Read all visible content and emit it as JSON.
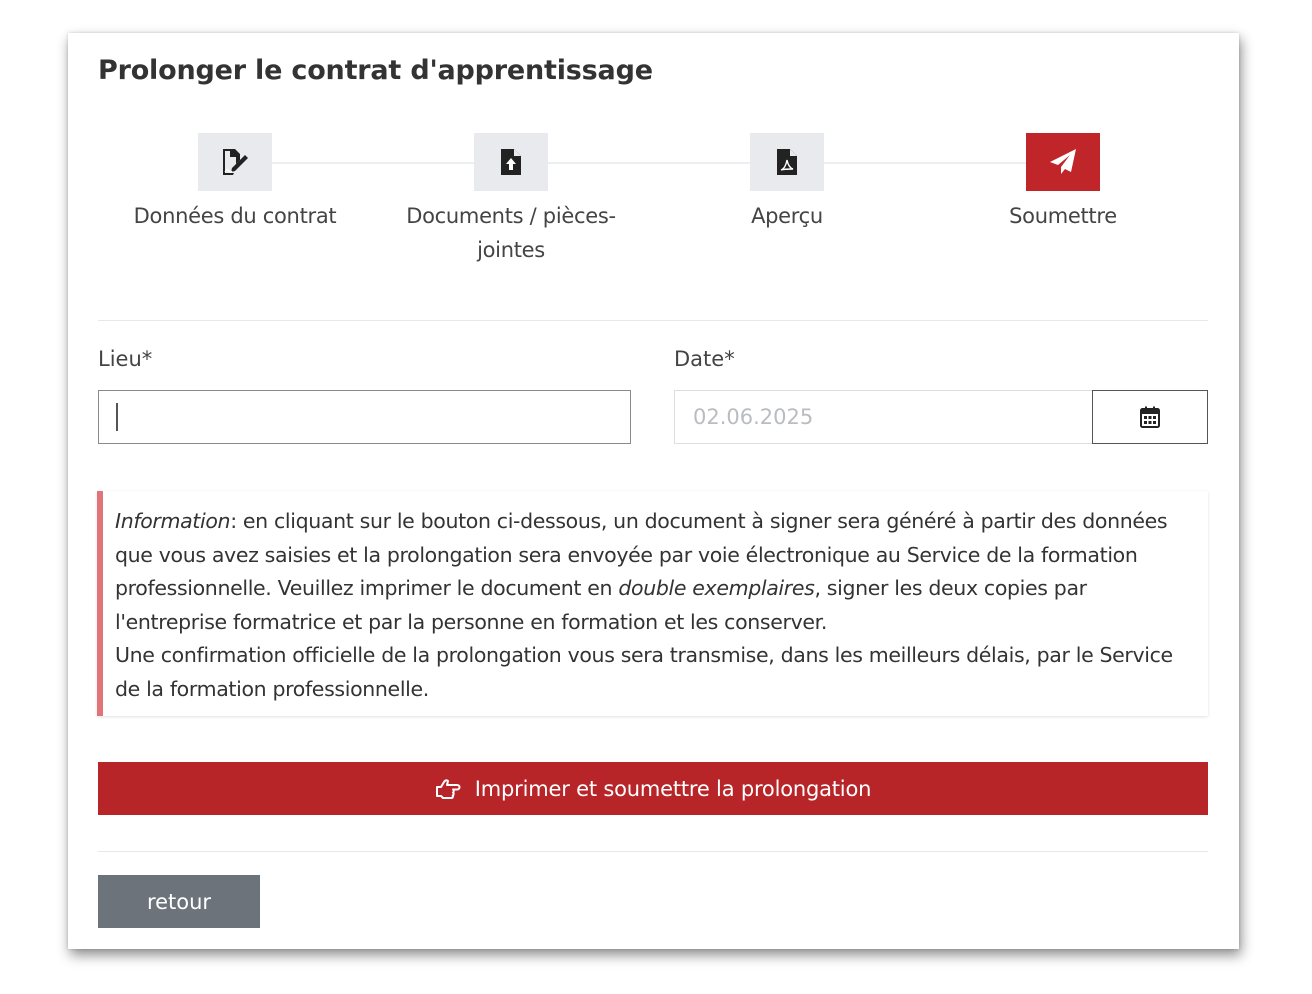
{
  "page": {
    "title": "Prolonger le contrat d'apprentissage"
  },
  "stepper": {
    "steps": [
      {
        "label": "Données du contrat",
        "icon": "file-signature-icon",
        "active": false
      },
      {
        "label": "Documents / pièces-jointes",
        "icon": "file-upload-icon",
        "active": false
      },
      {
        "label": "Aperçu",
        "icon": "file-pdf-icon",
        "active": false
      },
      {
        "label": "Soumettre",
        "icon": "paper-plane-icon",
        "active": true
      }
    ]
  },
  "form": {
    "lieu": {
      "label": "Lieu*",
      "value": ""
    },
    "date": {
      "label": "Date*",
      "placeholder": "02.06.2025",
      "button_icon": "calendar-icon"
    }
  },
  "info": {
    "lead": "Information",
    "text1": ": en cliquant sur le bouton ci-dessous, un document à signer sera généré à partir des données que vous avez saisies et la prolongation sera envoyée par voie électronique au Service de la formation professionnelle. Veuillez imprimer le document en ",
    "emphasis": "double exemplaires",
    "text2": ", signer les deux copies par l'entreprise formatrice et par la personne en formation et les conserver.",
    "paragraph2": "Une confirmation officielle de la prolongation vous sera transmise, dans les meilleurs délais, par le Service de la formation professionnelle."
  },
  "actions": {
    "submit_label": "Imprimer et soumettre la prolongation",
    "submit_icon": "hand-point-right-icon",
    "back_label": "retour"
  },
  "colors": {
    "accent": "#b72528",
    "active_step": "#c0252a",
    "info_border": "#e07479",
    "secondary_button": "#6c737b",
    "inactive_step": "#e9eaed"
  }
}
